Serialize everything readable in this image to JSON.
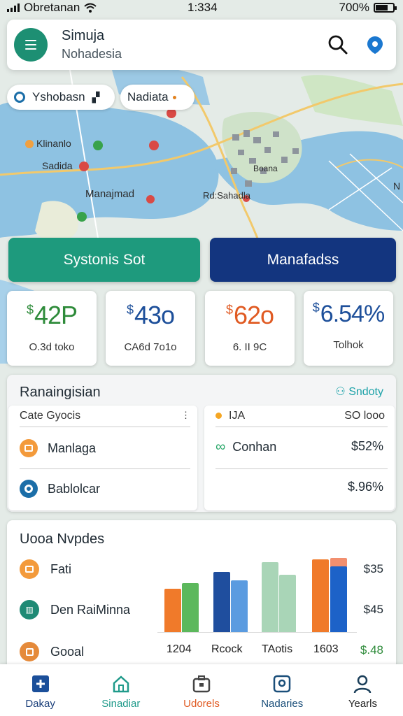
{
  "status_bar": {
    "carrier": "Obretanan",
    "time": "1:334",
    "battery": "700%"
  },
  "header": {
    "title": "Simuja",
    "subtitle": "Nohadesia",
    "icons": [
      "menu-icon",
      "search-icon",
      "location-icon"
    ]
  },
  "chips": [
    {
      "label": "Yshobasn",
      "icon": "car-icon"
    },
    {
      "label": "Nadiata"
    }
  ],
  "map_labels": [
    "Klinanlo",
    "Sadida",
    "Manajmad",
    "Rd:Sahadla",
    "Boana",
    "N"
  ],
  "actions": {
    "primary": "Systonis Sot",
    "secondary": "Manafadss"
  },
  "metrics": [
    {
      "currency": "$",
      "value": "42P",
      "label": "O.3d toko",
      "color": "#2e8b3a"
    },
    {
      "currency": "$",
      "value": "43o",
      "label": "CA6d 7o1o",
      "color": "#1d4f9a"
    },
    {
      "currency": "$",
      "value": "62o",
      "label": "6. II 9C",
      "color": "#e05a22"
    },
    {
      "currency": "$",
      "value": "6.54%",
      "label": "Tolhok",
      "color": "#1d4f9a"
    }
  ],
  "ranking": {
    "title": "Ranaingisian",
    "link": "Sndoty",
    "left": {
      "header": "Cate Gyocis",
      "rows": [
        "Manlaga",
        "Bablolcar"
      ]
    },
    "right": {
      "header_left": "IJA",
      "header_right": "SO looo",
      "rows": [
        {
          "label": "Conhan",
          "value": "$52%"
        },
        {
          "label": "",
          "value": "$.96%"
        }
      ]
    }
  },
  "updates": {
    "title": "Uooa Nvpdes",
    "rows": [
      {
        "label": "Fati",
        "value": "$35"
      },
      {
        "label": "Den RaiMinna",
        "value": "$45"
      },
      {
        "label": "Gooal",
        "value": "$.48"
      }
    ],
    "x_labels": [
      "1204",
      "Rcock",
      "TAotis",
      "1603"
    ],
    "colors": {
      "orange": "#f07a2a",
      "green": "#5cb85c",
      "navy": "#1f4e9e",
      "light_blue": "#5a9be0",
      "sage": "#a9d5b7",
      "salmon": "#f28f6f"
    }
  },
  "nav": [
    {
      "label": "Dakay",
      "icon": "plus-square-icon"
    },
    {
      "label": "Sinadiar",
      "icon": "home-icon"
    },
    {
      "label": "Udorels",
      "icon": "briefcase-icon"
    },
    {
      "label": "Nadaries",
      "icon": "location-square-icon"
    },
    {
      "label": "Yearls",
      "icon": "user-icon"
    }
  ]
}
